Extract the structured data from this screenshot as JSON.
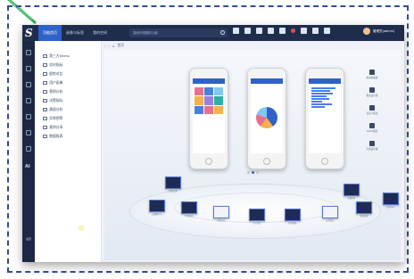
{
  "app": {
    "logo": "S"
  },
  "topbar": {
    "menu": [
      "功能首页",
      "画像与标签",
      "我的空间"
    ],
    "search_placeholder": "搜索你想要的功能",
    "icons": [
      "search-icon",
      "home-icon",
      "report-icon",
      "ai-icon",
      "lock-icon",
      "palette-icon",
      "bell-icon",
      "settings-icon",
      "grid-icon",
      "user-icon"
    ],
    "user_label": "管理员(admin)"
  },
  "breadcrumb": {
    "items": [
      "首页"
    ]
  },
  "sidebar": {
    "ai_label": "AI",
    "settings_label": "设置"
  },
  "tree": {
    "items": [
      "第三方Demo",
      "实时指标",
      "趋势对比",
      "用户画像",
      "营销分析",
      "决策指标",
      "渠道分析",
      "异常预警",
      "案例分享",
      "数据报表"
    ]
  },
  "right_panel": {
    "items": [
      "移动端看板",
      "报表设计器",
      "自定义报表",
      "ADAS报表",
      "大屏设计器"
    ]
  },
  "carousel": {
    "active_index": 1,
    "count": 3
  },
  "thumbnails": [
    "智慧交通",
    "云数据中心",
    "智慧园区",
    "销售分析",
    "生产监控",
    "物流看板",
    "运营监控",
    "能源管理",
    "指挥中心",
    "金融风控"
  ],
  "colors": {
    "topbar": "#1f2d4d",
    "accent": "#2f62c9",
    "frame": "#2f4f9a"
  }
}
